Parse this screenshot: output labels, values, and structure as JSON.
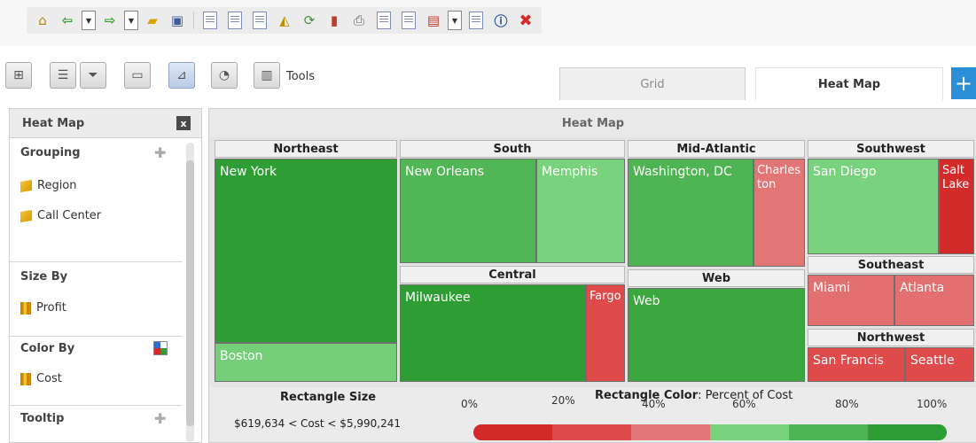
{
  "tabs": {
    "grid_label": "Grid",
    "heatmap_label": "Heat Map",
    "add_label": "+"
  },
  "toolbar2": {
    "tools_label": "Tools"
  },
  "panel": {
    "title": "Heat Map",
    "close_glyph": "x",
    "grouping": {
      "title": "Grouping",
      "items": [
        "Region",
        "Call Center"
      ]
    },
    "size_by": {
      "title": "Size By",
      "items": [
        "Profit"
      ]
    },
    "color_by": {
      "title": "Color By",
      "items": [
        "Cost"
      ]
    },
    "tooltip": {
      "title": "Tooltip"
    }
  },
  "heatmap": {
    "title": "Heat Map",
    "groups": [
      {
        "name": "Northeast",
        "cells": [
          {
            "label": "New York",
            "color": "#2e9e34"
          },
          {
            "label": "Boston",
            "color": "#74cf78"
          }
        ]
      },
      {
        "name": "South",
        "cells": [
          {
            "label": "New Orleans",
            "color": "#51b656"
          },
          {
            "label": "Memphis",
            "color": "#79d27d"
          }
        ]
      },
      {
        "name": "Central",
        "cells": [
          {
            "label": "Milwaukee",
            "color": "#2e9e34"
          },
          {
            "label": "Fargo",
            "color": "#df4a4a"
          }
        ]
      },
      {
        "name": "Mid-Atlantic",
        "cells": [
          {
            "label": "Washington, DC",
            "color": "#4fb554"
          },
          {
            "label": "Charleston",
            "color": "#e27575"
          }
        ]
      },
      {
        "name": "Web",
        "cells": [
          {
            "label": "Web",
            "color": "#3aa83f"
          }
        ]
      },
      {
        "name": "Southwest",
        "cells": [
          {
            "label": "San Diego",
            "color": "#79d27d"
          },
          {
            "label": "Salt Lake",
            "color": "#d32a2a"
          }
        ]
      },
      {
        "name": "Southeast",
        "cells": [
          {
            "label": "Miami",
            "color": "#e27070"
          },
          {
            "label": "Atlanta",
            "color": "#e27070"
          }
        ]
      },
      {
        "name": "Northwest",
        "cells": [
          {
            "label": "San Francis",
            "color": "#df4a4a"
          },
          {
            "label": "Seattle",
            "color": "#df4a4a"
          }
        ]
      }
    ]
  },
  "legend": {
    "size_title": "Rectangle Size",
    "size_range": "$619,634 < Cost < $5,990,241",
    "color_title_bold": "Rectangle Color",
    "color_title_rest": ": Percent of Cost",
    "ticks": [
      "0%",
      "20%",
      "40%",
      "60%",
      "80%",
      "100%"
    ],
    "gradient": [
      "#d32a2a",
      "#df4a4a",
      "#e27575",
      "#79d27d",
      "#4fb554",
      "#2e9e34"
    ]
  }
}
